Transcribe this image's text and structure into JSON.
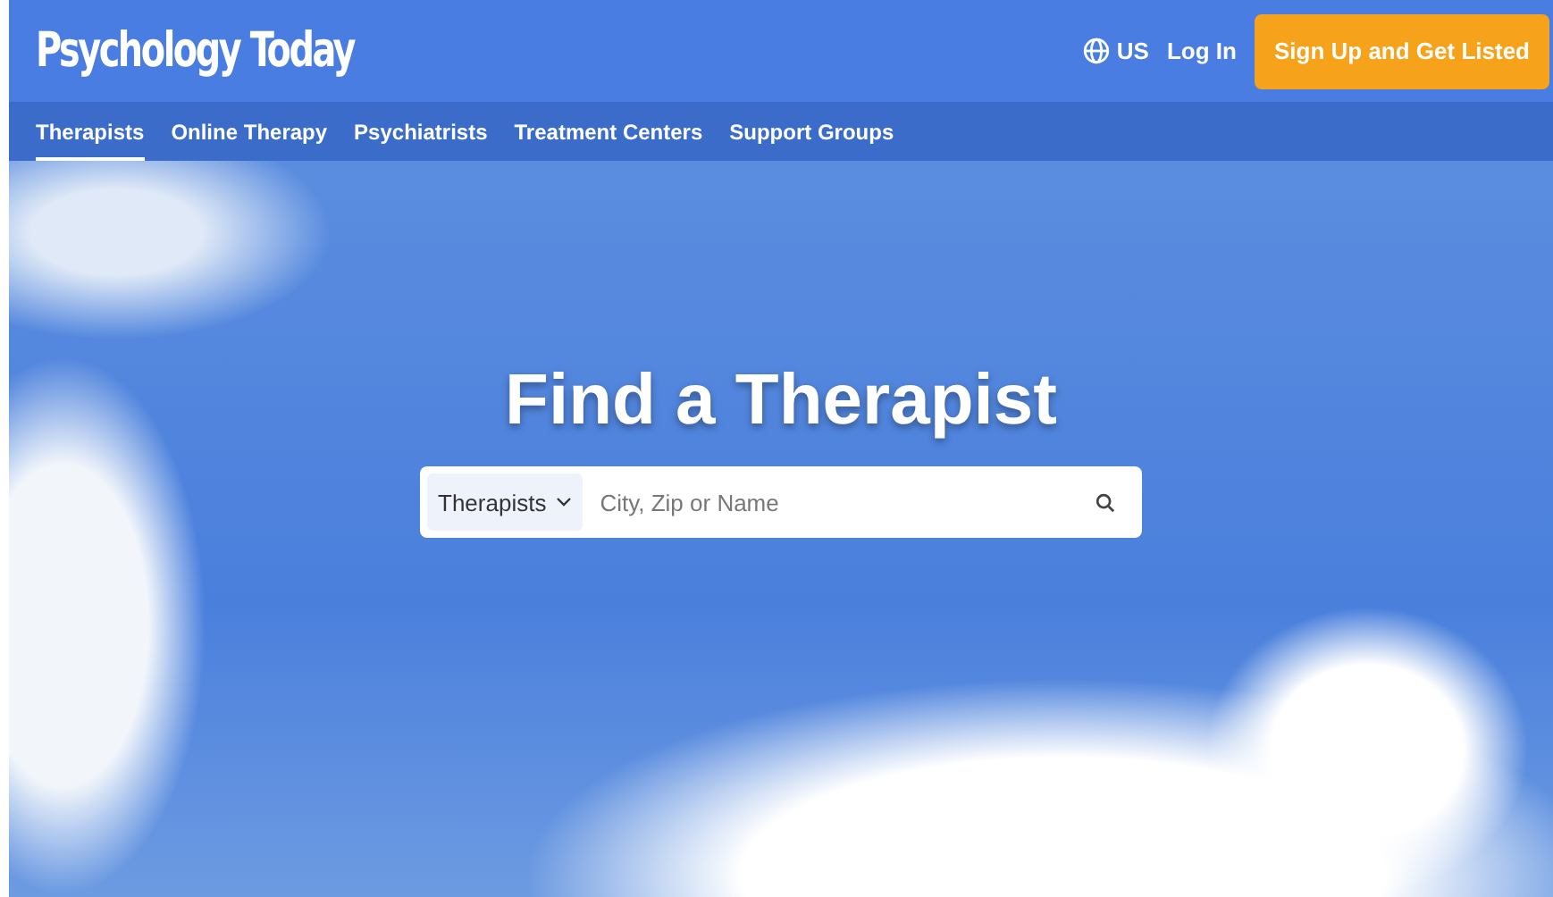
{
  "header": {
    "logo": "Psychology Today",
    "region": "US",
    "login": "Log In",
    "signup": "Sign Up and Get Listed"
  },
  "nav": [
    {
      "label": "Therapists",
      "selected": true
    },
    {
      "label": "Online Therapy",
      "selected": false
    },
    {
      "label": "Psychiatrists",
      "selected": false
    },
    {
      "label": "Treatment Centers",
      "selected": false
    },
    {
      "label": "Support Groups",
      "selected": false
    }
  ],
  "hero": {
    "title": "Find a Therapist",
    "search": {
      "category": "Therapists",
      "placeholder": "City, Zip or Name"
    }
  }
}
